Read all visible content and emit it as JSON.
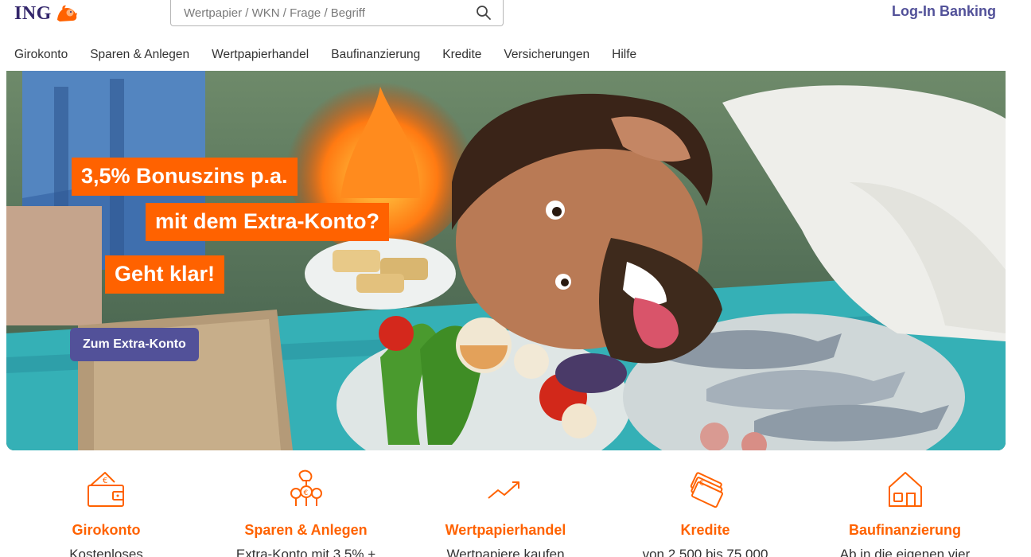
{
  "header": {
    "logo_text": "ING",
    "search_placeholder": "Wertpapier / WKN / Frage / Begriff",
    "login_label": "Log-In Banking"
  },
  "nav": {
    "items": [
      "Girokonto",
      "Sparen & Anlegen",
      "Wertpapierhandel",
      "Baufinanzierung",
      "Kredite",
      "Versicherungen",
      "Hilfe"
    ]
  },
  "hero": {
    "line1": "3,5% Bonuszins p.a.",
    "line2": "mit dem Extra-Konto?",
    "line3": "Geht klar!",
    "cta_label": "Zum Extra-Konto"
  },
  "tiles": [
    {
      "icon": "wallet-icon",
      "title": "Girokonto",
      "desc": "Kostenloses"
    },
    {
      "icon": "money-plant-icon",
      "title": "Sparen & Anlegen",
      "desc": "Extra-Konto mit 3,5% +"
    },
    {
      "icon": "trend-up-icon",
      "title": "Wertpapierhandel",
      "desc": "Wertpapiere kaufen"
    },
    {
      "icon": "banknotes-icon",
      "title": "Kredite",
      "desc": "von 2.500 bis 75.000"
    },
    {
      "icon": "house-icon",
      "title": "Baufinanzierung",
      "desc": "Ab in die eigenen vier"
    }
  ],
  "colors": {
    "brand_orange": "#ff6200",
    "brand_indigo": "#525199",
    "logo_indigo": "#33266b"
  }
}
